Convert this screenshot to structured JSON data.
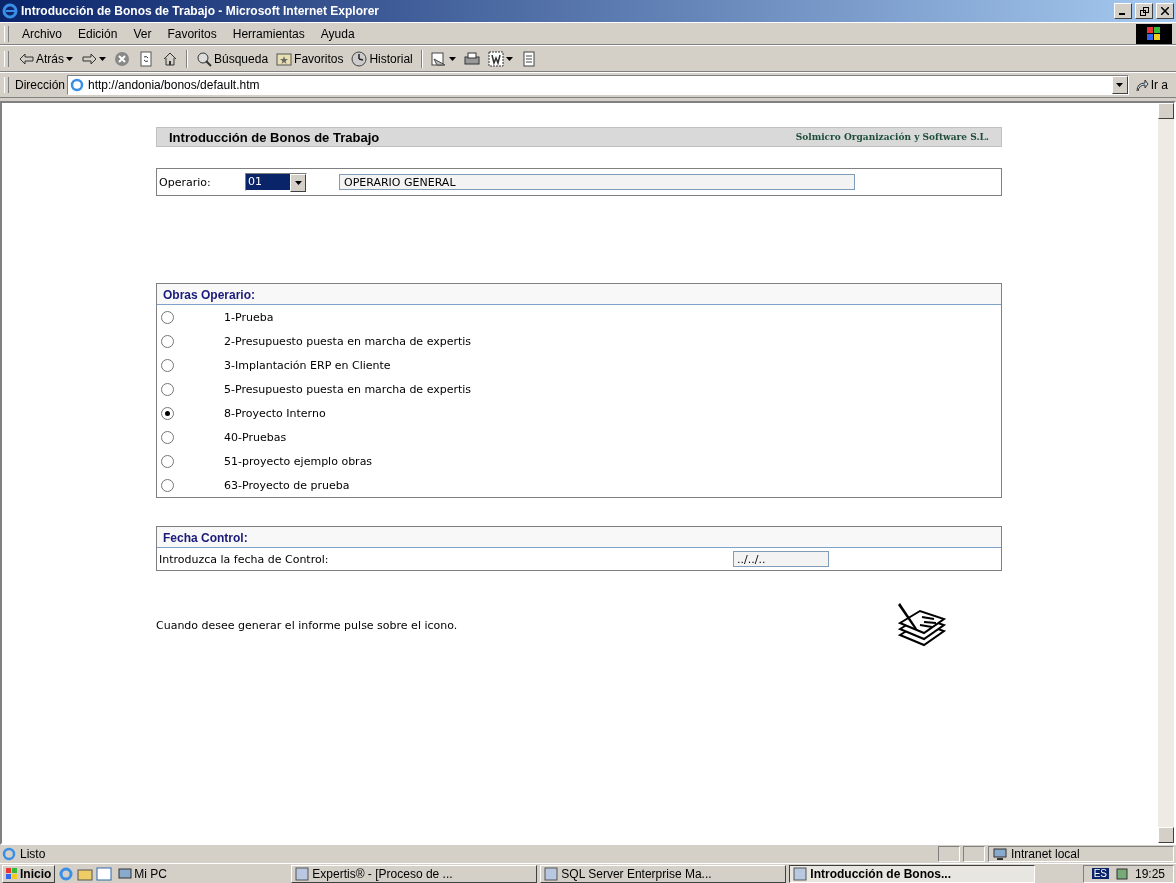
{
  "window": {
    "title": "Introducción de Bonos de Trabajo - Microsoft Internet Explorer"
  },
  "menu": [
    "Archivo",
    "Edición",
    "Ver",
    "Favoritos",
    "Herramientas",
    "Ayuda"
  ],
  "toolbar": [
    {
      "kind": "back",
      "label": "Atrás"
    },
    {
      "kind": "forward"
    },
    {
      "kind": "stop"
    },
    {
      "kind": "refresh"
    },
    {
      "kind": "home"
    },
    {
      "kind": "search",
      "label": "Búsqueda"
    },
    {
      "kind": "favorites",
      "label": "Favoritos"
    },
    {
      "kind": "history",
      "label": "Historial"
    },
    {
      "kind": "mail"
    },
    {
      "kind": "print"
    },
    {
      "kind": "edit"
    },
    {
      "kind": "discuss"
    }
  ],
  "address": {
    "label": "Dirección",
    "url": "http://andonia/bonos/default.htm",
    "go": "Ir a"
  },
  "page": {
    "title": "Introducción de Bonos de Trabajo",
    "company": "Solmicro Organización y Software S.L.",
    "operario": {
      "label": "Operario:",
      "code": "01",
      "name": "OPERARIO GENERAL"
    },
    "obras": {
      "title": "Obras Operario:",
      "items": [
        {
          "label": "1-Prueba",
          "selected": false
        },
        {
          "label": "2-Presupuesto puesta en marcha de expertis",
          "selected": false
        },
        {
          "label": "3-Implantación ERP en Cliente",
          "selected": false
        },
        {
          "label": "5-Presupuesto puesta en marcha de expertis",
          "selected": false
        },
        {
          "label": "8-Proyecto Interno",
          "selected": true
        },
        {
          "label": "40-Pruebas",
          "selected": false
        },
        {
          "label": "51-proyecto ejemplo obras",
          "selected": false
        },
        {
          "label": "63-Proyecto de prueba",
          "selected": false
        }
      ]
    },
    "fecha": {
      "title": "Fecha Control:",
      "label": "Introduzca la fecha de Control:",
      "value": "../../.."
    },
    "instruction": "Cuando desee generar el informe pulse sobre el icono."
  },
  "status_bar": {
    "text": "Listo",
    "zone": "Intranet local"
  },
  "taskbar": {
    "start": "Inicio",
    "quick": "Mi PC",
    "tasks": [
      {
        "label": "Expertis® - [Proceso de ...",
        "selected": false
      },
      {
        "label": "SQL Server Enterprise Ma...",
        "selected": false
      },
      {
        "label": "Introducción de Bonos...",
        "selected": true
      }
    ],
    "language": "ES",
    "clock": "19:25"
  }
}
